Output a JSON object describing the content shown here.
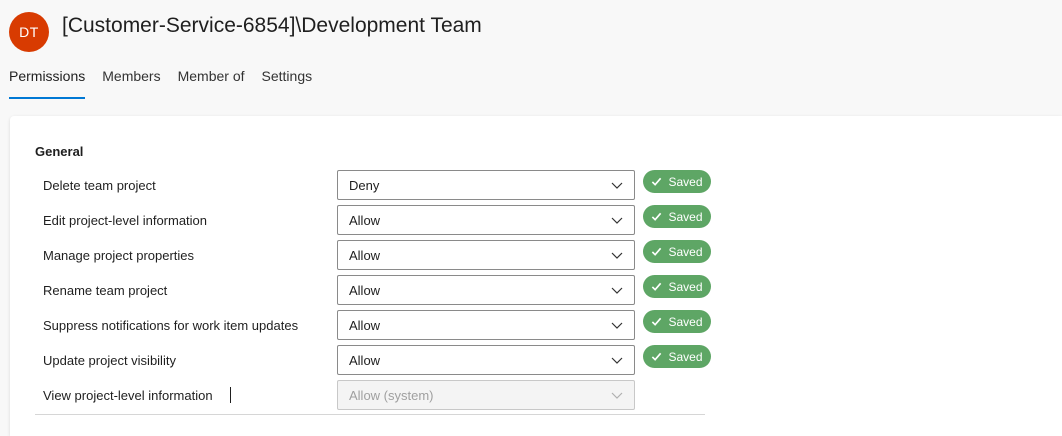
{
  "header": {
    "avatar_initials": "DT",
    "avatar_color": "#d83b01",
    "title": "[Customer-Service-6854]\\Development Team"
  },
  "tabs": [
    {
      "label": "Permissions",
      "active": true
    },
    {
      "label": "Members",
      "active": false
    },
    {
      "label": "Member of",
      "active": false
    },
    {
      "label": "Settings",
      "active": false
    }
  ],
  "accent_color": "#0078d4",
  "saved_color": "#5ea665",
  "section": {
    "title": "General",
    "permissions": [
      {
        "label": "Delete team project",
        "value": "Deny",
        "status": "Saved",
        "disabled": false
      },
      {
        "label": "Edit project-level information",
        "value": "Allow",
        "status": "Saved",
        "disabled": false
      },
      {
        "label": "Manage project properties",
        "value": "Allow",
        "status": "Saved",
        "disabled": false
      },
      {
        "label": "Rename team project",
        "value": "Allow",
        "status": "Saved",
        "disabled": false
      },
      {
        "label": "Suppress notifications for work item updates",
        "value": "Allow",
        "status": "Saved",
        "disabled": false
      },
      {
        "label": "Update project visibility",
        "value": "Allow",
        "status": "Saved",
        "disabled": false
      },
      {
        "label": "View project-level information",
        "value": "Allow (system)",
        "status": "",
        "disabled": true
      }
    ]
  }
}
